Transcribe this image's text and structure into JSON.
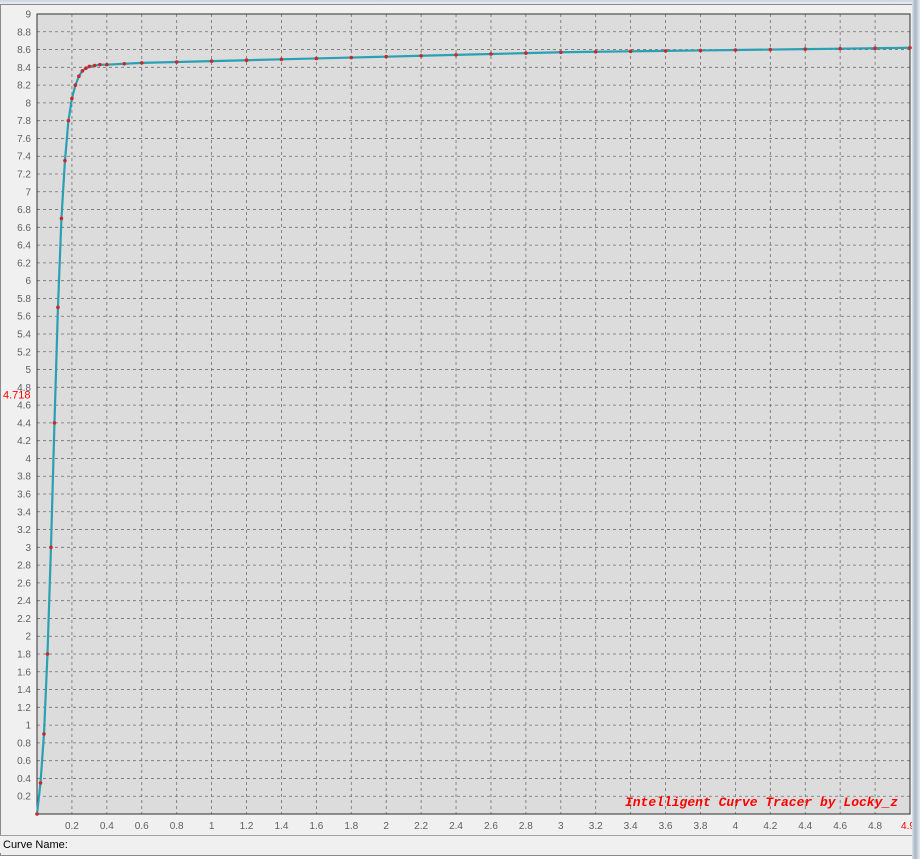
{
  "watermark": "Intelligent Curve Tracer by Locky_z",
  "cursor": {
    "y_readout": "4.718",
    "x_readout": "4.9"
  },
  "curve_name": {
    "label": "Curve Name:",
    "value": ""
  },
  "colors": {
    "plot_bg": "#dcdcdc",
    "grid": "#707070",
    "curve": "#2aa0b4",
    "points": "#c82828",
    "axis_text": "#606060",
    "watermark": "#ff0000",
    "readout": "#ff0000"
  },
  "chart_data": {
    "type": "line",
    "title": "",
    "xlabel": "",
    "ylabel": "",
    "xlim": [
      0,
      5
    ],
    "ylim": [
      0,
      9
    ],
    "grid": true,
    "x_ticks": [
      "0.2",
      "0.4",
      "0.6",
      "0.8",
      "1",
      "1.2",
      "1.4",
      "1.6",
      "1.8",
      "2",
      "2.2",
      "2.4",
      "2.6",
      "2.8",
      "3",
      "3.2",
      "3.4",
      "3.6",
      "3.8",
      "4",
      "4.2",
      "4.4",
      "4.6",
      "4.8"
    ],
    "y_ticks": [
      "0.2",
      "0.4",
      "0.6",
      "0.8",
      "1",
      "1.2",
      "1.4",
      "1.6",
      "1.8",
      "2",
      "2.2",
      "2.4",
      "2.6",
      "2.8",
      "3",
      "3.2",
      "3.4",
      "3.6",
      "3.8",
      "4",
      "4.2",
      "4.4",
      "4.6",
      "4.8",
      "5",
      "5.2",
      "5.4",
      "5.6",
      "5.8",
      "6",
      "6.2",
      "6.4",
      "6.6",
      "6.8",
      "7",
      "7.2",
      "7.4",
      "7.6",
      "7.8",
      "8",
      "8.2",
      "8.4",
      "8.6",
      "8.8",
      "9"
    ],
    "series": [
      {
        "x": [
          0,
          0.02,
          0.04,
          0.06,
          0.08,
          0.1,
          0.12,
          0.14,
          0.16,
          0.18,
          0.2,
          0.22,
          0.24,
          0.26,
          0.28,
          0.3,
          0.33,
          0.36,
          0.4,
          0.5,
          0.6,
          0.8,
          1.0,
          1.2,
          1.4,
          1.6,
          1.8,
          2.0,
          2.2,
          2.4,
          2.6,
          2.8,
          3.0,
          3.2,
          3.4,
          3.6,
          3.8,
          4.0,
          4.2,
          4.4,
          4.6,
          4.8,
          5.0
        ],
        "y": [
          0,
          0.35,
          0.9,
          1.8,
          3.0,
          4.4,
          5.7,
          6.7,
          7.35,
          7.8,
          8.05,
          8.2,
          8.3,
          8.36,
          8.39,
          8.41,
          8.42,
          8.43,
          8.43,
          8.44,
          8.45,
          8.46,
          8.47,
          8.48,
          8.49,
          8.5,
          8.51,
          8.52,
          8.53,
          8.54,
          8.55,
          8.56,
          8.57,
          8.575,
          8.58,
          8.585,
          8.59,
          8.595,
          8.6,
          8.605,
          8.61,
          8.615,
          8.62
        ]
      }
    ]
  }
}
